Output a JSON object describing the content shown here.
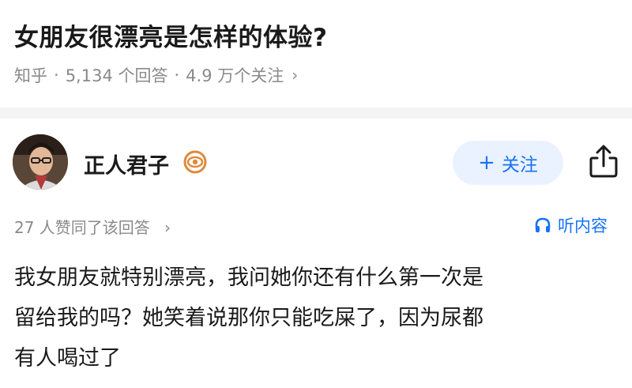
{
  "question": {
    "title": "女朋友很漂亮是怎样的体验?",
    "source": "知乎",
    "answers": "5,134 个回答",
    "followers": "4.9 万个关注",
    "separator": "·",
    "chevron": "›"
  },
  "author": {
    "name": "正人君子",
    "badge_icon": "eye-badge-icon"
  },
  "actions": {
    "follow_plus": "+",
    "follow_label": "关注",
    "share_icon": "share-icon"
  },
  "answer_meta": {
    "likes": "27 人赞同了该回答",
    "chevron": "›",
    "listen_label": "听内容",
    "listen_icon": "headphones-icon"
  },
  "answer": {
    "lines": [
      "我女朋友就特别漂亮，我问她你还有什么第一次是",
      "留给我的吗？她笑着说那你只能吃屎了，因为尿都",
      "有人喝过了"
    ]
  },
  "colors": {
    "accent": "#1772f6",
    "follow_bg": "#eaf2ff",
    "meta_text": "#8a8a8a",
    "badge": "#e08a3c"
  }
}
